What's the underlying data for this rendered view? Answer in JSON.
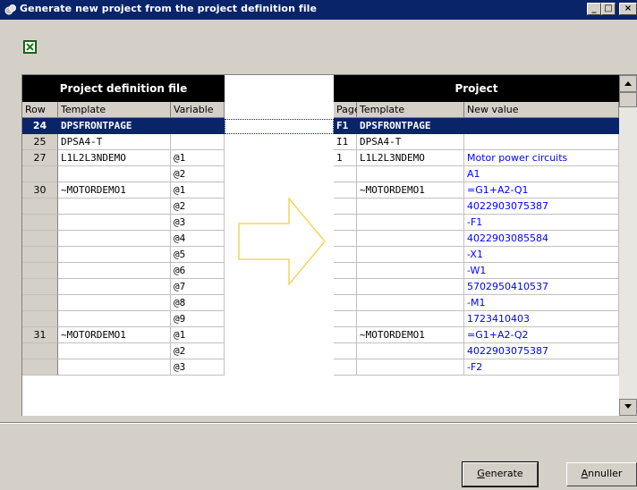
{
  "window": {
    "title": "Generate new project from the project definition file",
    "minimize_glyph": "_",
    "maximize_glyph": "□",
    "close_glyph": "×"
  },
  "toolbar": {
    "excel_icon": "excel-icon"
  },
  "left_table": {
    "title": "Project definition file",
    "columns": [
      "Row",
      "Template",
      "Variable"
    ]
  },
  "right_table": {
    "title": "Project",
    "columns": [
      "Page",
      "Template",
      "New value"
    ]
  },
  "rows": [
    {
      "row": "24",
      "template": "DPSFRONTPAGE",
      "variable": "",
      "page": "F1",
      "project_template": "DPSFRONTPAGE",
      "new_value": "",
      "selected": true
    },
    {
      "row": "25",
      "template": "DPSA4-T",
      "variable": "",
      "page": "I1",
      "project_template": "DPSA4-T",
      "new_value": ""
    },
    {
      "row": "27",
      "template": "L1L2L3NDEMO",
      "variable": "@1",
      "page": "1",
      "project_template": "L1L2L3NDEMO",
      "new_value": "Motor power circuits"
    },
    {
      "row": "",
      "template": "",
      "variable": "@2",
      "page": "",
      "project_template": "",
      "new_value": "A1"
    },
    {
      "row": "30",
      "template": "~MOTORDEMO1",
      "variable": "@1",
      "page": "",
      "project_template": "~MOTORDEMO1",
      "new_value": "=G1+A2-Q1"
    },
    {
      "row": "",
      "template": "",
      "variable": "@2",
      "page": "",
      "project_template": "",
      "new_value": "4022903075387"
    },
    {
      "row": "",
      "template": "",
      "variable": "@3",
      "page": "",
      "project_template": "",
      "new_value": "-F1"
    },
    {
      "row": "",
      "template": "",
      "variable": "@4",
      "page": "",
      "project_template": "",
      "new_value": "4022903085584"
    },
    {
      "row": "",
      "template": "",
      "variable": "@5",
      "page": "",
      "project_template": "",
      "new_value": "-X1"
    },
    {
      "row": "",
      "template": "",
      "variable": "@6",
      "page": "",
      "project_template": "",
      "new_value": "-W1"
    },
    {
      "row": "",
      "template": "",
      "variable": "@7",
      "page": "",
      "project_template": "",
      "new_value": "5702950410537"
    },
    {
      "row": "",
      "template": "",
      "variable": "@8",
      "page": "",
      "project_template": "",
      "new_value": "-M1"
    },
    {
      "row": "",
      "template": "",
      "variable": "@9",
      "page": "",
      "project_template": "",
      "new_value": "1723410403"
    },
    {
      "row": "31",
      "template": "~MOTORDEMO1",
      "variable": "@1",
      "page": "",
      "project_template": "~MOTORDEMO1",
      "new_value": "=G1+A2-Q2"
    },
    {
      "row": "",
      "template": "",
      "variable": "@2",
      "page": "",
      "project_template": "",
      "new_value": "4022903075387"
    },
    {
      "row": "",
      "template": "",
      "variable": "@3",
      "page": "",
      "project_template": "",
      "new_value": "-F2"
    }
  ],
  "buttons": {
    "generate_label_mnemonic": "G",
    "generate_label_rest": "enerate",
    "cancel_label_mnemonic": "A",
    "cancel_label_rest": "nnuller"
  },
  "colors": {
    "title_bar": "#0a246a",
    "selection": "#0a246a",
    "value_text": "#0000ff",
    "arrow": "#f0d040"
  }
}
